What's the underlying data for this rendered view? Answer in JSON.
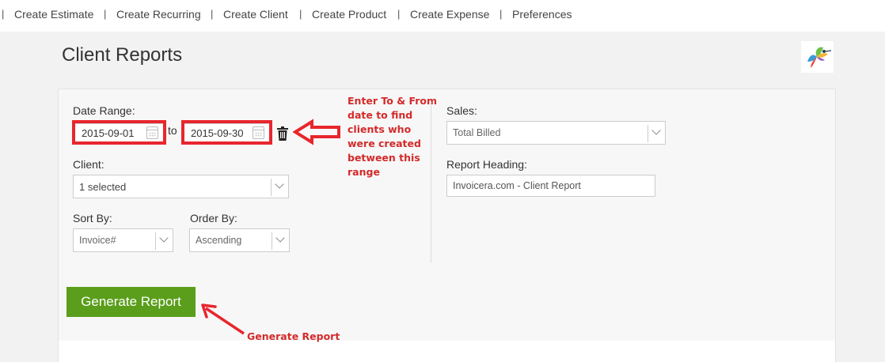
{
  "nav": {
    "items": [
      "Create Estimate",
      "Create Recurring",
      "Create Client",
      "Create Product",
      "Create Expense",
      "Preferences"
    ],
    "separator": "|"
  },
  "page": {
    "title": "Client Reports"
  },
  "form": {
    "date_range_label": "Date Range:",
    "from_date": "2015-09-01",
    "to_label": "to",
    "to_date": "2015-09-30",
    "client_label": "Client:",
    "client_value": "1 selected",
    "sort_by_label": "Sort By:",
    "sort_by_value": "Invoice#",
    "order_by_label": "Order By:",
    "order_by_value": "Ascending",
    "sales_label": "Sales:",
    "sales_value": "Total Billed",
    "report_heading_label": "Report Heading:",
    "report_heading_value": "Invoicera.com - Client Report",
    "generate_button": "Generate Report"
  },
  "annotations": {
    "date_note_lines": [
      "Enter To & From",
      "date to find",
      "clients who",
      "were created",
      "between this",
      "range"
    ],
    "button_note": "Generate Report",
    "color": "#e8262d"
  },
  "colors": {
    "primary_button": "#5a9e1b",
    "highlight": "#e8262d"
  }
}
